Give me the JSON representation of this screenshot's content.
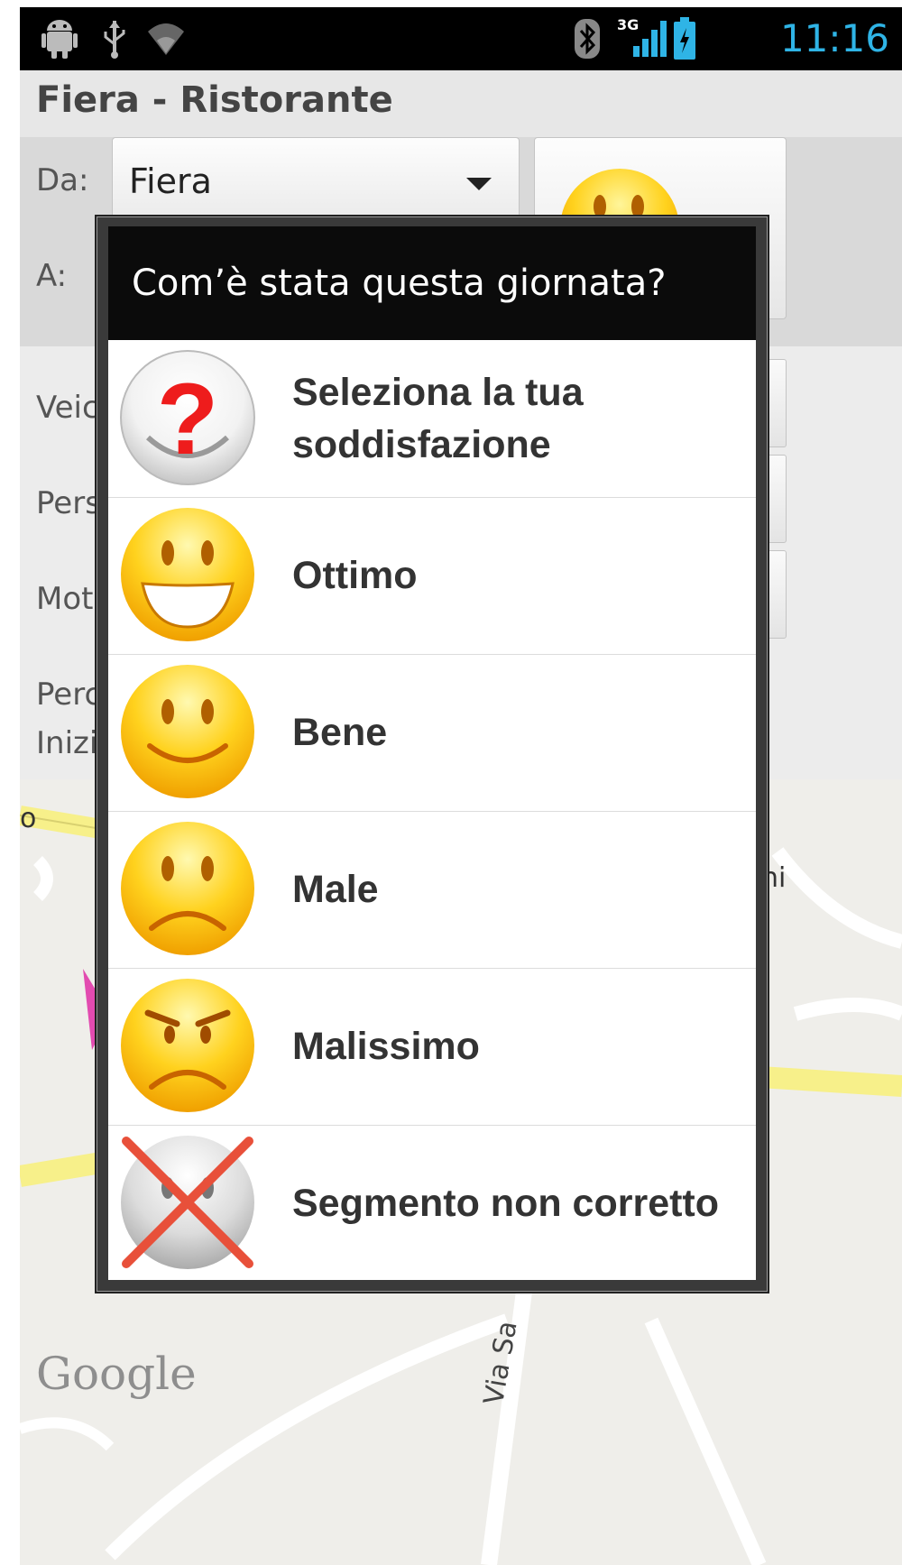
{
  "status_bar": {
    "time": "11:16",
    "network_label": "3G",
    "icons": [
      "android-icon",
      "usb-icon",
      "wifi-icon",
      "bluetooth-icon",
      "signal-icon",
      "battery-icon"
    ]
  },
  "app": {
    "title": "Fiera - Ristorante"
  },
  "form": {
    "from_label": "Da:",
    "from_value": "Fiera",
    "to_label": "A:",
    "partial_labels": [
      "Veic",
      "Pers",
      "Moti",
      "Perc",
      "Inizi"
    ]
  },
  "dialog": {
    "title": "Com’è stata questa giornata?",
    "items": [
      {
        "label": "Seleziona la tua\nsoddisfazione",
        "icon": "question-face-icon"
      },
      {
        "label": "Ottimo",
        "icon": "big-smile-face-icon"
      },
      {
        "label": "Bene",
        "icon": "smile-face-icon"
      },
      {
        "label": "Male",
        "icon": "sad-face-icon"
      },
      {
        "label": "Malissimo",
        "icon": "angry-face-icon"
      },
      {
        "label": "Segmento non corretto",
        "icon": "crossed-face-icon"
      }
    ]
  },
  "map": {
    "street_label": "Via Sa",
    "map_fragments": [
      "o",
      "ni"
    ],
    "brand": "Google"
  },
  "colors": {
    "clock": "#2fb4e6",
    "dialog_title_bg": "#0b0b0b",
    "face_yellow": "#ffd21e",
    "cross_red": "#e8503a"
  }
}
